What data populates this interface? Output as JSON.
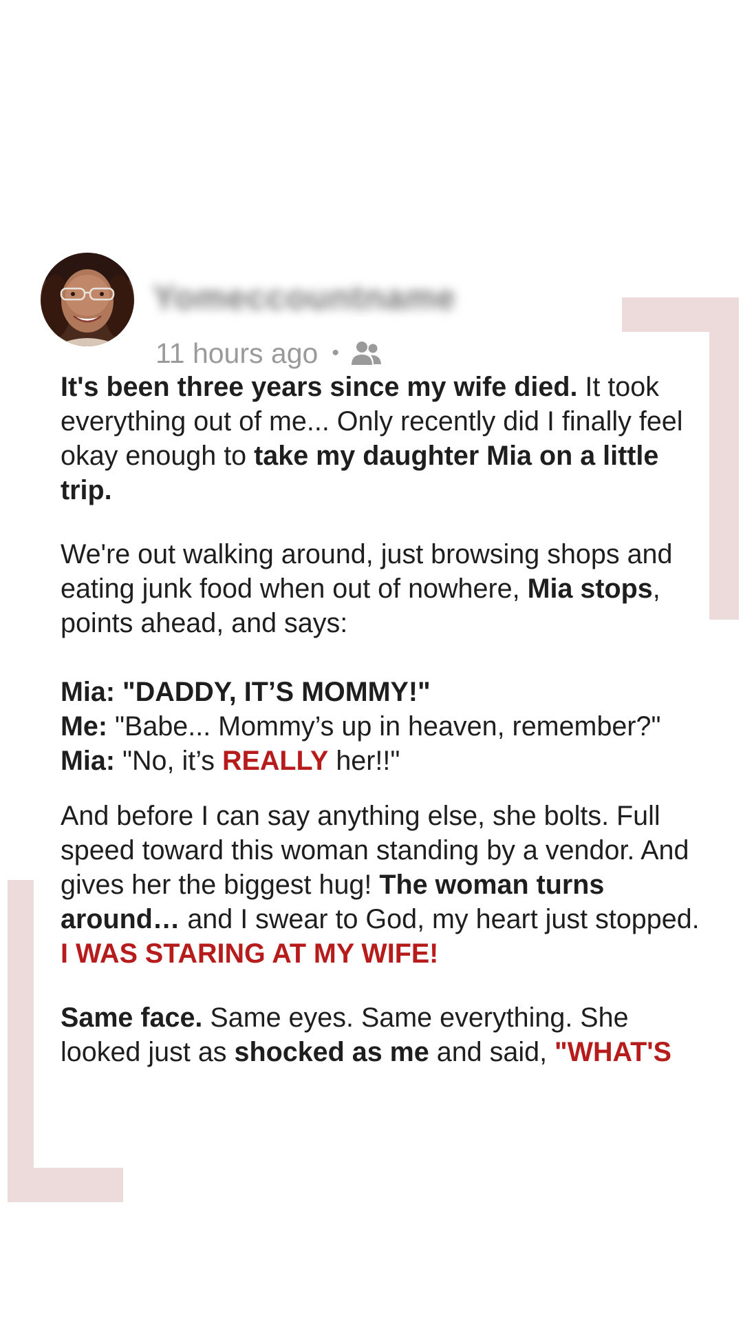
{
  "post": {
    "author": "Yomeccountname",
    "time": "11 hours ago",
    "separator": "•",
    "audience_icon": "friends-icon",
    "p1": {
      "b1": "It's been three years since my wife died.",
      "t1": " It took everything out of me... Only recently did I finally feel okay enough to ",
      "b2": "take my daughter Mia on a little trip."
    },
    "p2": {
      "t1": "We're out walking around, just browsing shops and eating junk food when out of nowhere, ",
      "b1": "Mia stops",
      "t2": ", points ahead, and says:"
    },
    "dialogue": {
      "l1": "Mia: \"DADDY, IT’S MOMMY!\"",
      "l2_speaker": "Me:",
      "l2_text": " \"Babe... Mommy’s up in heaven, remember?\"",
      "l3_speaker": "Mia:",
      "l3_t1": " \"No, it’s ",
      "l3_red": "REALLY",
      "l3_t2": " her!!\""
    },
    "p3": {
      "t1": "And before I can say anything else, she bolts. Full speed toward this woman standing by a vendor. And gives her the biggest hug! ",
      "b1": "The woman turns around…",
      "t2": " and I swear to God, my heart just stopped. ",
      "red": "I WAS STARING AT MY WIFE!"
    },
    "p4": {
      "b1": "Same face.",
      "t1": " Same eyes. Same everything. She looked just as ",
      "b2": "shocked as me",
      "t2": " and said, ",
      "red": "\"WHAT'S"
    }
  },
  "colors": {
    "accent_red": "#b71c1c",
    "bracket": "#eddadb",
    "meta_gray": "#9a9a9a"
  }
}
